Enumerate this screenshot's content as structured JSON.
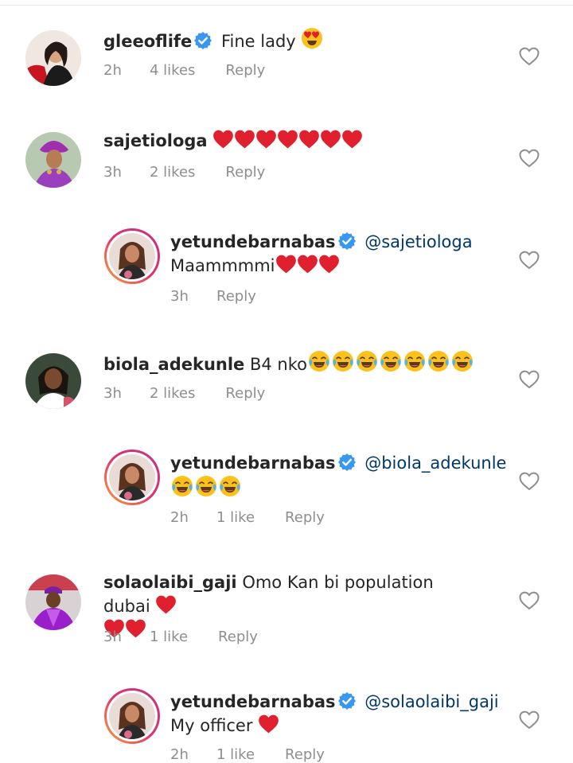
{
  "comments": [
    {
      "username": "gleeoflife",
      "verified": true,
      "text": "Fine lady",
      "time": "2h",
      "likes": "4 likes",
      "reply": "Reply"
    },
    {
      "username": "sajetiologa",
      "verified": false,
      "text": "",
      "time": "3h",
      "likes": "2 likes",
      "reply": "Reply"
    },
    {
      "username": "yetundebarnabas",
      "verified": true,
      "mention": "@sajetiologa",
      "text": "Maammmmi",
      "time": "3h",
      "likes": "",
      "reply": "Reply"
    },
    {
      "username": "biola_adekunle",
      "verified": false,
      "text": "B4 nko",
      "time": "3h",
      "likes": "2 likes",
      "reply": "Reply"
    },
    {
      "username": "yetundebarnabas",
      "verified": true,
      "mention": "@biola_adekunle",
      "text": "",
      "time": "2h",
      "likes": "1 like",
      "reply": "Reply"
    },
    {
      "username": "solaolaibi_gaji",
      "verified": false,
      "text": "Omo Kan bi population dubai",
      "time": "3h",
      "likes": "1 like",
      "reply": "Reply"
    },
    {
      "username": "yetundebarnabas",
      "verified": true,
      "mention": "@solaolaibi_gaji",
      "text": "My officer",
      "time": "2h",
      "likes": "1 like",
      "reply": "Reply"
    }
  ],
  "icons": {
    "verified": "verified-badge-icon",
    "like": "heart-outline-icon",
    "heart_emoji": "red-heart-emoji",
    "love_eyes_emoji": "heart-eyes-emoji",
    "laugh_emoji": "tears-of-joy-emoji"
  },
  "colors": {
    "text": "#262626",
    "muted": "#8e8e8e",
    "mention": "#00376b",
    "verified": "#3897f0",
    "heart": "#e0202e"
  }
}
